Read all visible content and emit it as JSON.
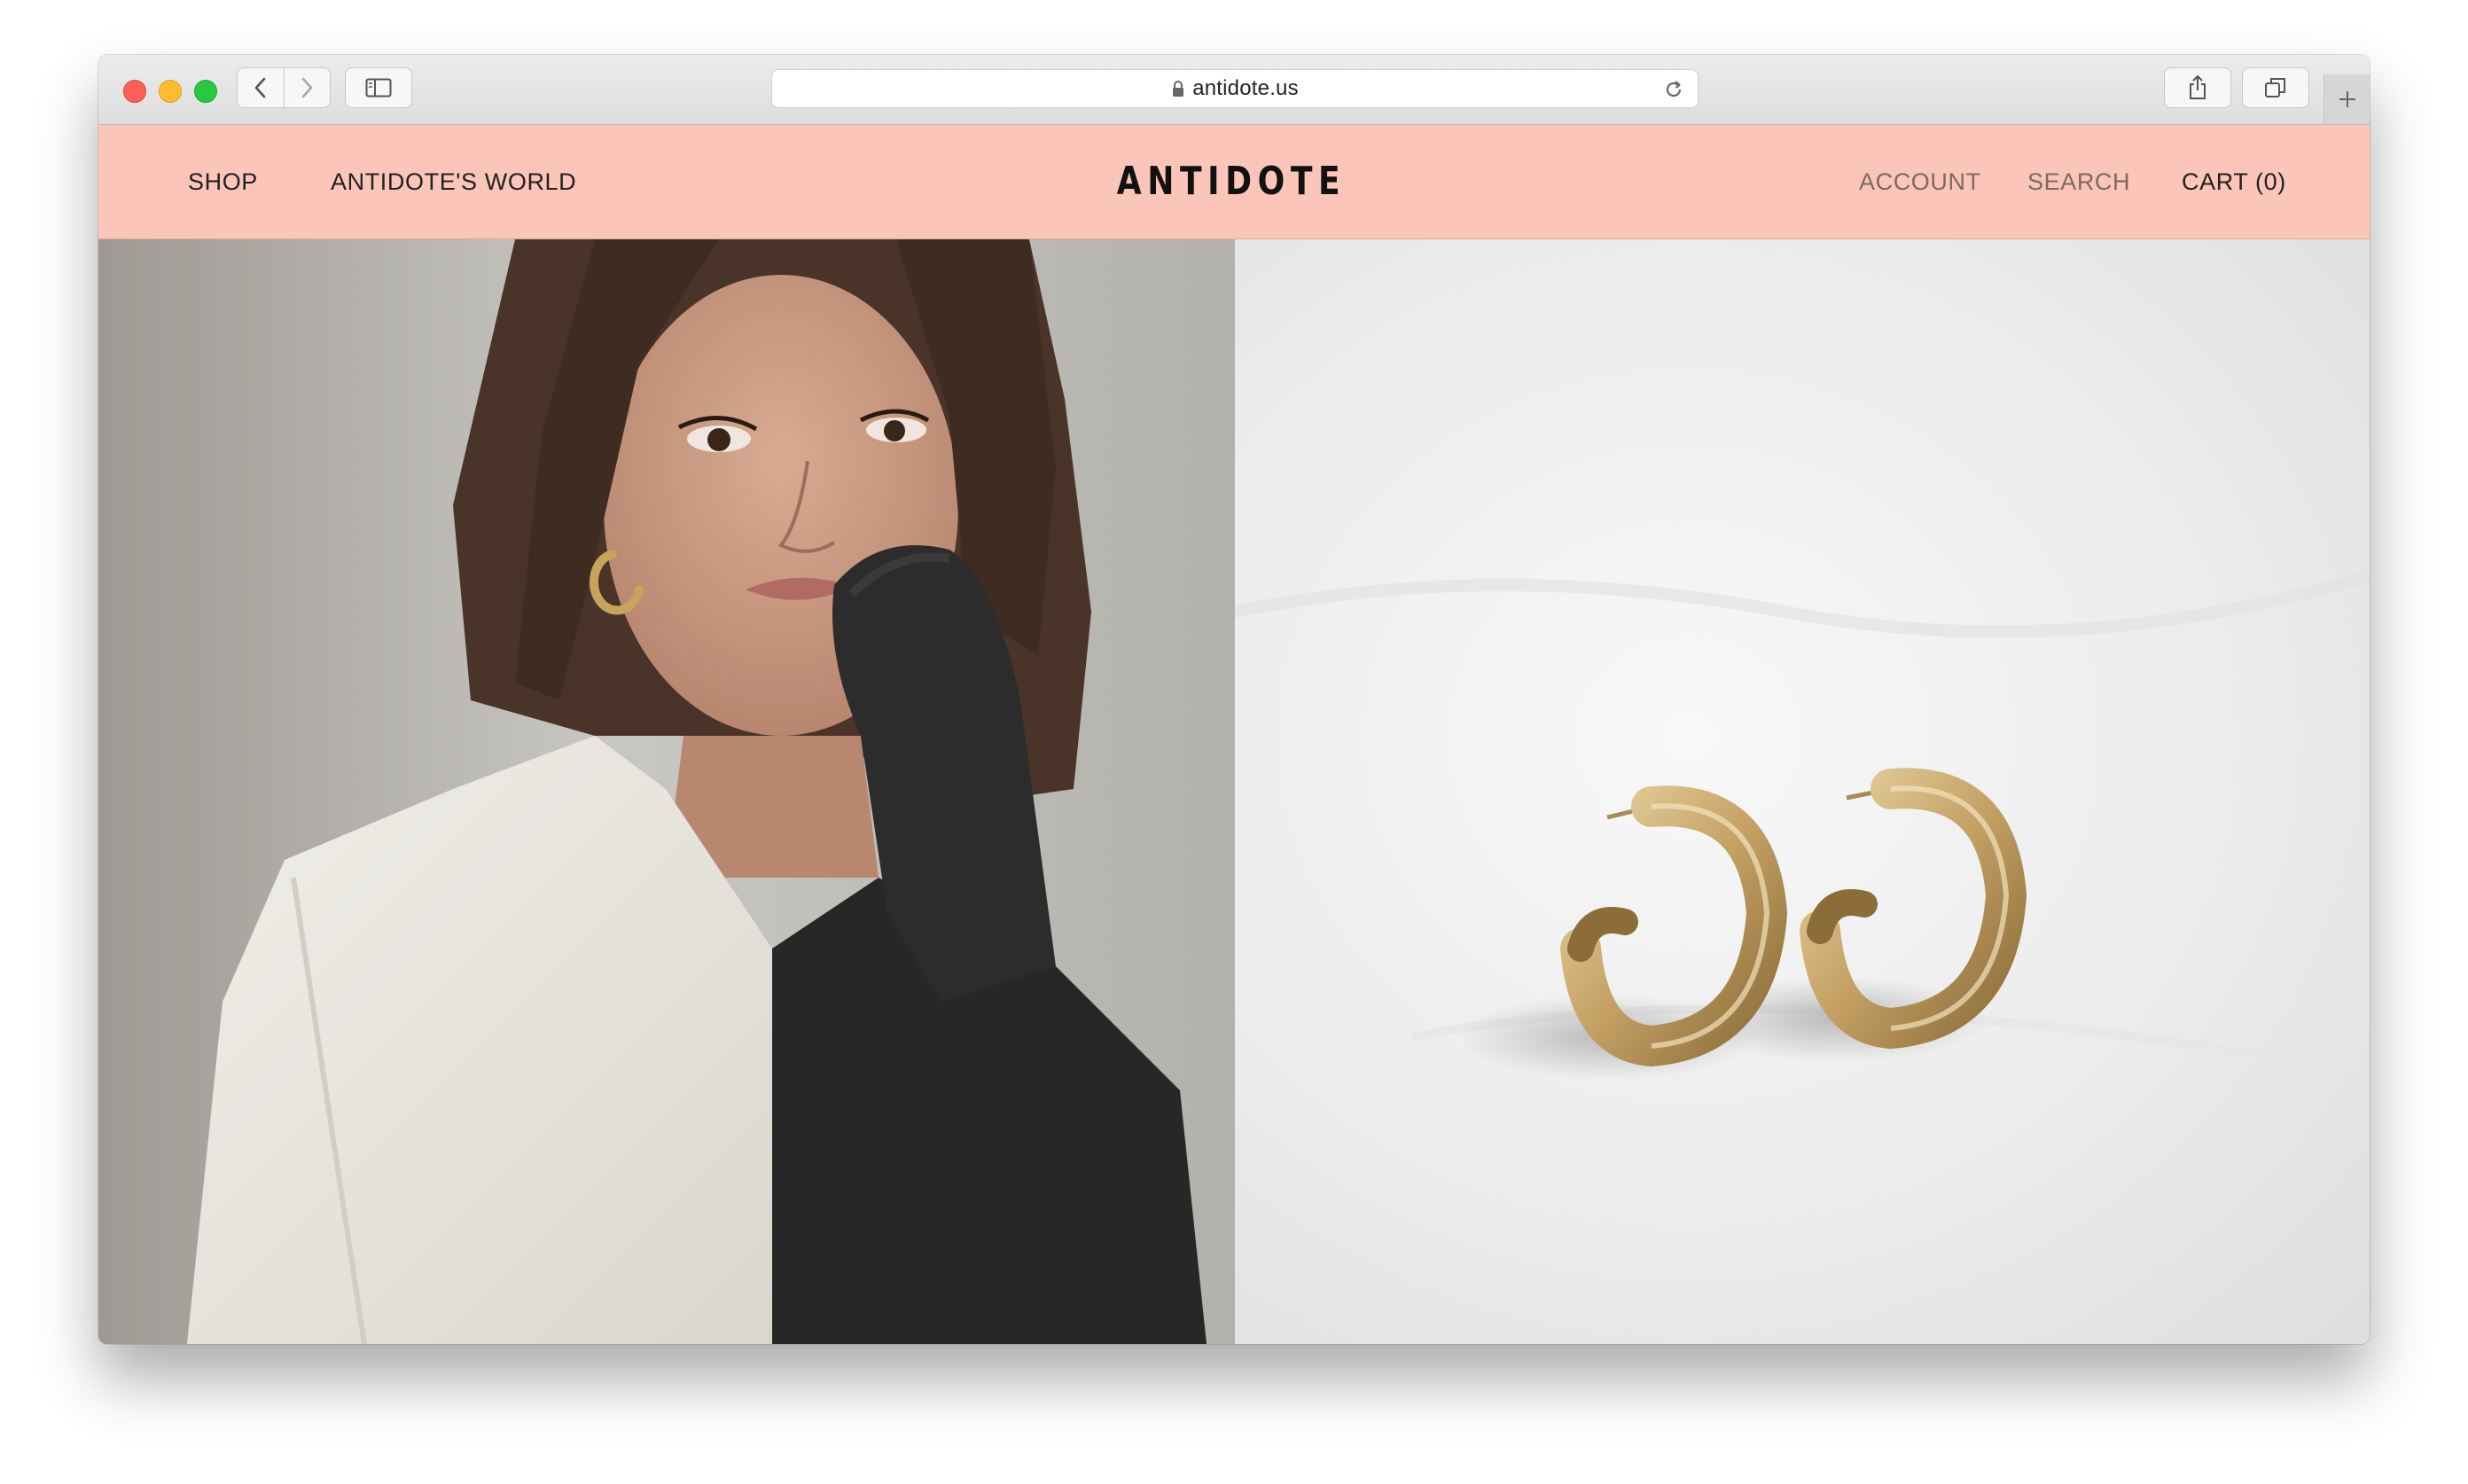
{
  "browser": {
    "url": "antidote.us",
    "icons": [
      "back-icon",
      "forward-icon",
      "sidebar-icon",
      "lock-icon",
      "reload-icon",
      "share-icon",
      "tabs-icon",
      "plus-icon"
    ]
  },
  "site": {
    "logo": "ANTIDOTE",
    "nav_left": [
      "SHOP",
      "ANTIDOTE'S WORLD"
    ],
    "nav_right": {
      "account": "ACCOUNT",
      "search": "SEARCH",
      "cart": "CART (0)"
    },
    "header_color": "#fcc5b9"
  },
  "hero": {
    "left_image": "woman-in-two-tone-sweater-photo",
    "right_image": "gold-hoop-earrings-photo"
  }
}
